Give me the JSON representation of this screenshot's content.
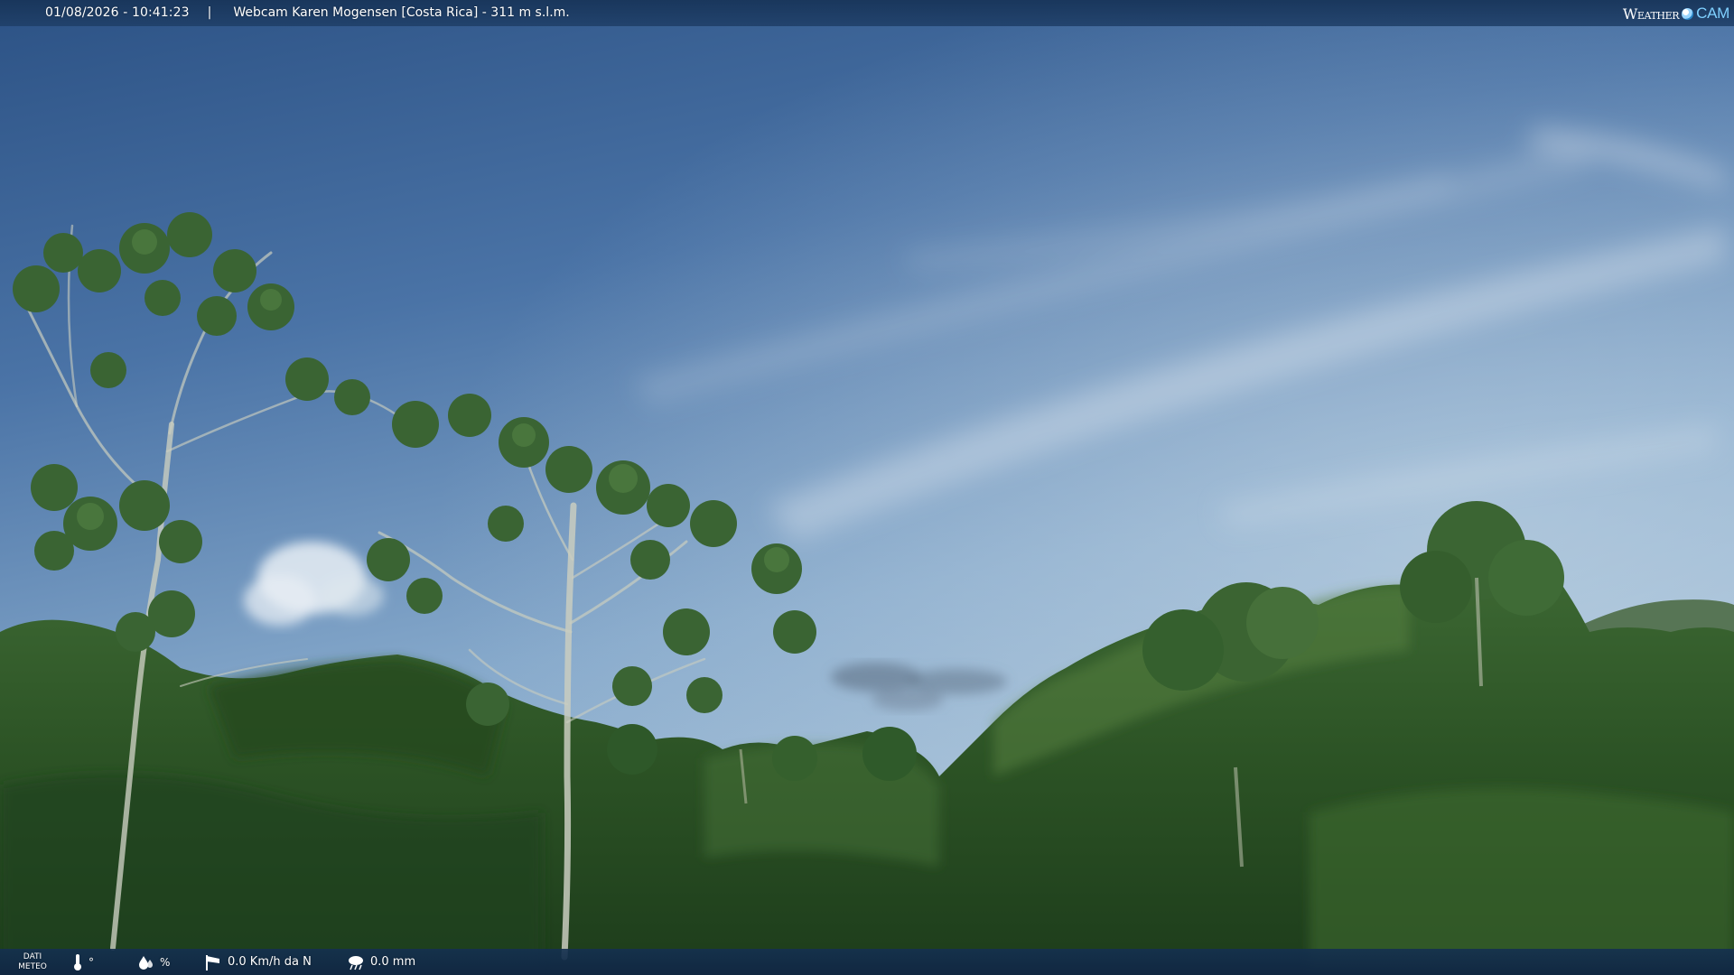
{
  "overlay_top": {
    "timestamp": "01/08/2026 - 10:41:23",
    "separator": "|",
    "camera_title": "Webcam Karen Mogensen [Costa Rica] - 311 m s.l.m."
  },
  "logo": {
    "word_weather": "Weather",
    "word_cam": "CAM"
  },
  "overlay_bottom": {
    "label_line1": "DATI",
    "label_line2": "METEO",
    "temperature_unit": "°",
    "humidity_unit": "%",
    "wind": "0.0 Km/h da N",
    "rain": "0.0 mm",
    "icons": [
      "thermometer-icon",
      "humidity-drop-icon",
      "wind-sock-icon",
      "rain-cloud-icon"
    ]
  },
  "colors": {
    "bar_background": "#1c3a62",
    "sky_top": "#2e5486",
    "sky_horizon": "#a7c2d8",
    "foliage": "#2f5a2a",
    "logo_accent": "#7fd0ff"
  }
}
